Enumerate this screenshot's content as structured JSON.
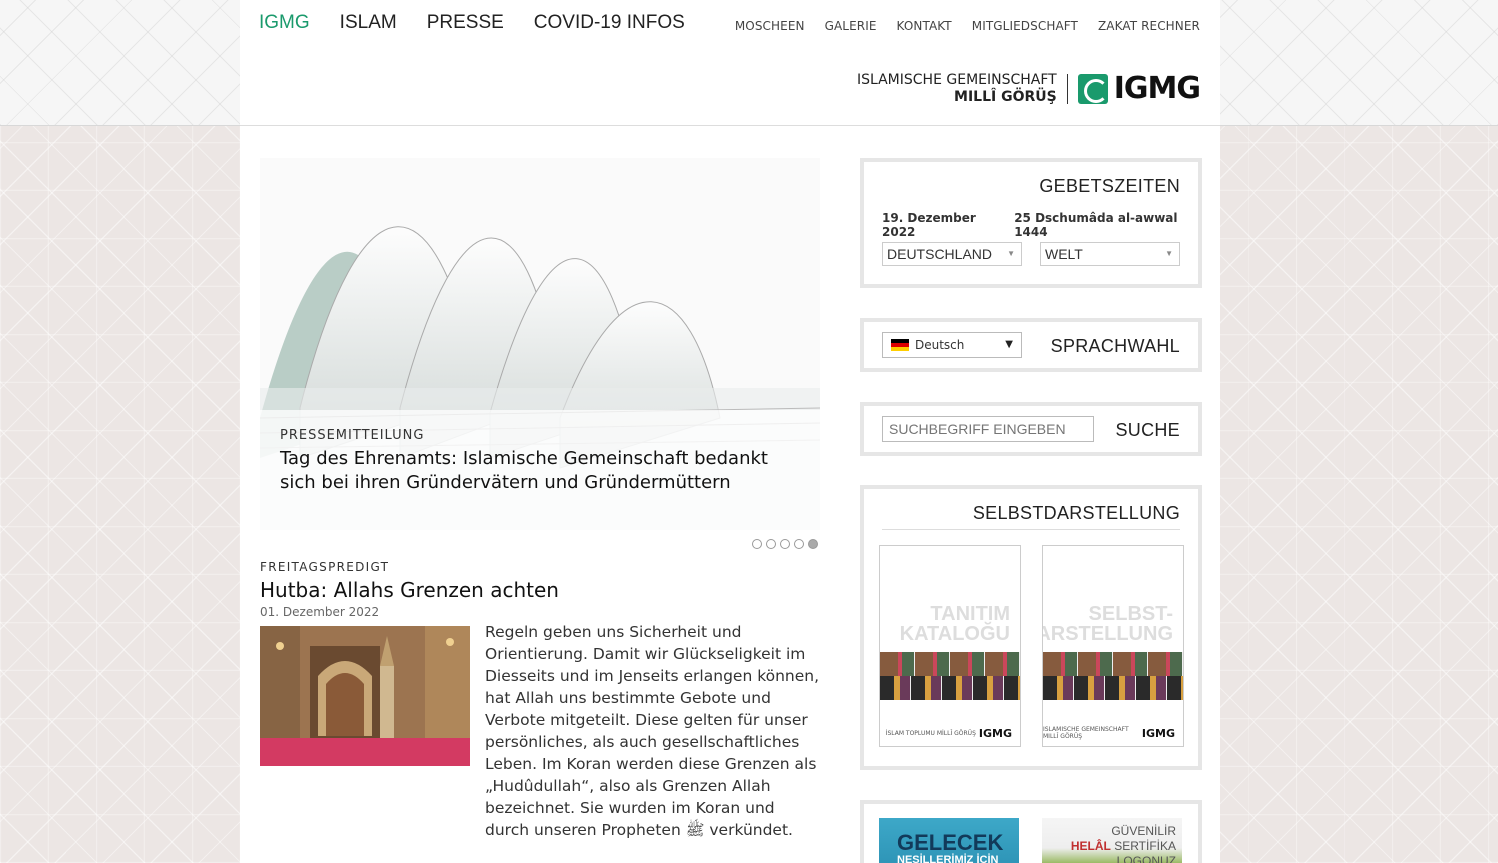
{
  "header": {
    "main_nav": [
      "IGMG",
      "ISLAM",
      "PRESSE",
      "COVID-19 INFOS"
    ],
    "sub_nav": [
      "MOSCHEEN",
      "GALERIE",
      "KONTAKT",
      "MITGLIEDSCHAFT",
      "ZAKAT RECHNER"
    ],
    "brand_line1": "ISLAMISCHE GEMEINSCHAFT",
    "brand_line2": "MILLÎ GÖRÜŞ",
    "logo_text": "IGMG",
    "accent_color": "#1a9a6c"
  },
  "slider": {
    "category": "PRESSEMITTEILUNG",
    "title": "Tag des Ehrenamts: Islamische Gemeinschaft bedankt sich bei ihren Gründervätern und Gründermüttern",
    "slide_count": 5,
    "active_slide": 5
  },
  "article": {
    "category": "FREITAGSPREDIGT",
    "title": "Hutba: Allahs Grenzen achten",
    "date": "01. Dezember 2022",
    "text": "Regeln geben uns Sicherheit und Orientierung. Damit wir Glückseligkeit im Diesseits und im Jenseits erlangen können, hat Allah uns bestimmte Gebote und Verbote mitgeteilt. Diese gelten für unser persönliches, als auch gesellschaftliches Leben. Im Koran werden diese Grenzen als „Hudûdullah“, also als Grenzen Allah bezeichnet. Sie wurden im Koran und durch unseren Propheten ﷺ verkündet."
  },
  "prayer": {
    "title": "GEBETSZEITEN",
    "date_greg": "19. Dezember 2022",
    "date_hijri": "25 Dschumâda al-awwal 1444",
    "country": "DEUTSCHLAND",
    "region": "WELT"
  },
  "language": {
    "title": "SPRACHWAHL",
    "selected": "Deutsch"
  },
  "search": {
    "title": "SUCHE",
    "placeholder": "SUCHBEGRIFF EINGEBEN"
  },
  "selbst": {
    "title": "SELBSTDARSTELLUNG",
    "brochures": [
      {
        "line1": "TANITIM",
        "line2": "KATALOĞU",
        "footer": "İSLAM TOPLUMU MİLLÎ GÖRÜŞ",
        "logo": "IGMG"
      },
      {
        "line1": "SELBST-",
        "line2": "DARSTELLUNG",
        "footer": "ISLAMISCHE GEMEINSCHAFT MILLÎ GÖRÜŞ",
        "logo": "IGMG"
      }
    ]
  },
  "ads": {
    "ad1_title": "GELECEK",
    "ad1_sub": "NESİLLERİMİZ İÇİN",
    "ad2_line1": "GÜVENİLİR",
    "ad2_line2a": "HELÂL",
    "ad2_line2b": " SERTİFİKA",
    "ad2_line3": "LOGONUZ"
  }
}
